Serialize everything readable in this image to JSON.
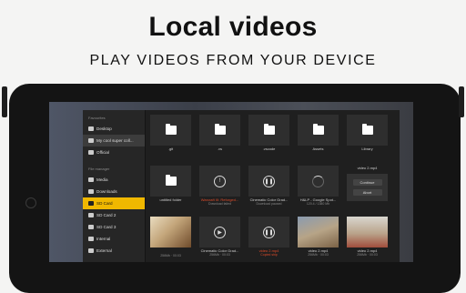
{
  "headline": "Local videos",
  "subheadline": "PLAY VIDEOS FROM YOUR DEVICE",
  "sidebar": {
    "favorites_header": "Favourites",
    "favorites": [
      {
        "label": "Desktop"
      },
      {
        "label": "My cool super coll..."
      },
      {
        "label": "Official"
      }
    ],
    "file_manager_header": "File manager",
    "locations": [
      {
        "label": "Media",
        "icon": "media-icon"
      },
      {
        "label": "Downloads",
        "icon": "download-icon"
      },
      {
        "label": "SD Card",
        "icon": "sd-card-icon"
      },
      {
        "label": "SD Card 2",
        "icon": "sd-card-icon"
      },
      {
        "label": "SD Card 3",
        "icon": "sd-card-icon"
      },
      {
        "label": "Internal",
        "icon": "storage-icon"
      },
      {
        "label": "External",
        "icon": "storage-icon"
      }
    ]
  },
  "grid": {
    "row1": [
      {
        "label": ".git",
        "icon": "folder-icon"
      },
      {
        "label": ".vs",
        "icon": "folder-icon"
      },
      {
        "label": ".vscode",
        "icon": "folder-icon"
      },
      {
        "label": "Assets",
        "icon": "folder-icon"
      },
      {
        "label": "Library",
        "icon": "folder-icon"
      }
    ],
    "row2": [
      {
        "label": "untitled folder",
        "icon": "folder-icon"
      },
      {
        "label": "Warcraft III: Reforged...",
        "sub": "Download failed",
        "icon": "error-icon"
      },
      {
        "label": "Cinematic Color Grad...",
        "sub": "Download paused",
        "icon": "pause-icon"
      },
      {
        "label": "H&LP - Google Spot...",
        "sub": "120.4 / 1380 Mb",
        "icon": "loading-icon"
      },
      {
        "label": "video 2.mp4",
        "sub": "",
        "icon": "video-icon"
      }
    ],
    "menu": {
      "continue": "Continue",
      "abort": "Abort"
    },
    "row3": [
      {
        "label": "",
        "sub": "256Mb  ·  00:03",
        "icon": "thumbnail"
      },
      {
        "label": "Cinematic Color Grad...",
        "sub": "256Mb  ·  00:03",
        "icon": "thumbnail"
      },
      {
        "label": "video 2.mp4",
        "sub": "Copied ship",
        "icon": "pause-icon"
      },
      {
        "label": "video 2.mp4",
        "sub": "256Mb  ·  00:03",
        "icon": "thumbnail"
      },
      {
        "label": "video 2.mp4",
        "sub": "256Mb  ·  00:03",
        "icon": "thumbnail"
      }
    ]
  },
  "colors": {
    "accent": "#f0b800",
    "error": "#e04c2a"
  }
}
